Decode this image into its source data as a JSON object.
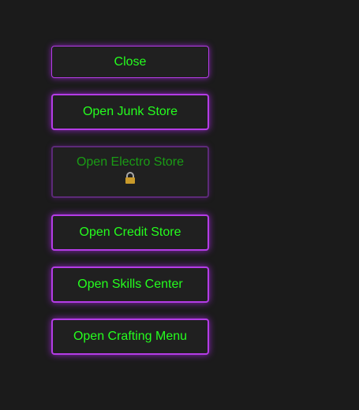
{
  "menu": {
    "close_label": "Close",
    "junk_label": "Open Junk Store",
    "electro_label": "Open Electro Store",
    "electro_locked": true,
    "credit_label": "Open Credit Store",
    "skills_label": "Open Skills Center",
    "crafting_label": "Open Crafting Menu"
  },
  "colors": {
    "background": "#1b1b1b",
    "button_bg": "#202020",
    "text": "#25ff1e",
    "text_disabled": "#1a9c15",
    "border": "#b43ce6",
    "border_disabled": "#5c2a78",
    "lock": "#c99a2a"
  },
  "icons": {
    "electro_lock": "lock-icon"
  }
}
